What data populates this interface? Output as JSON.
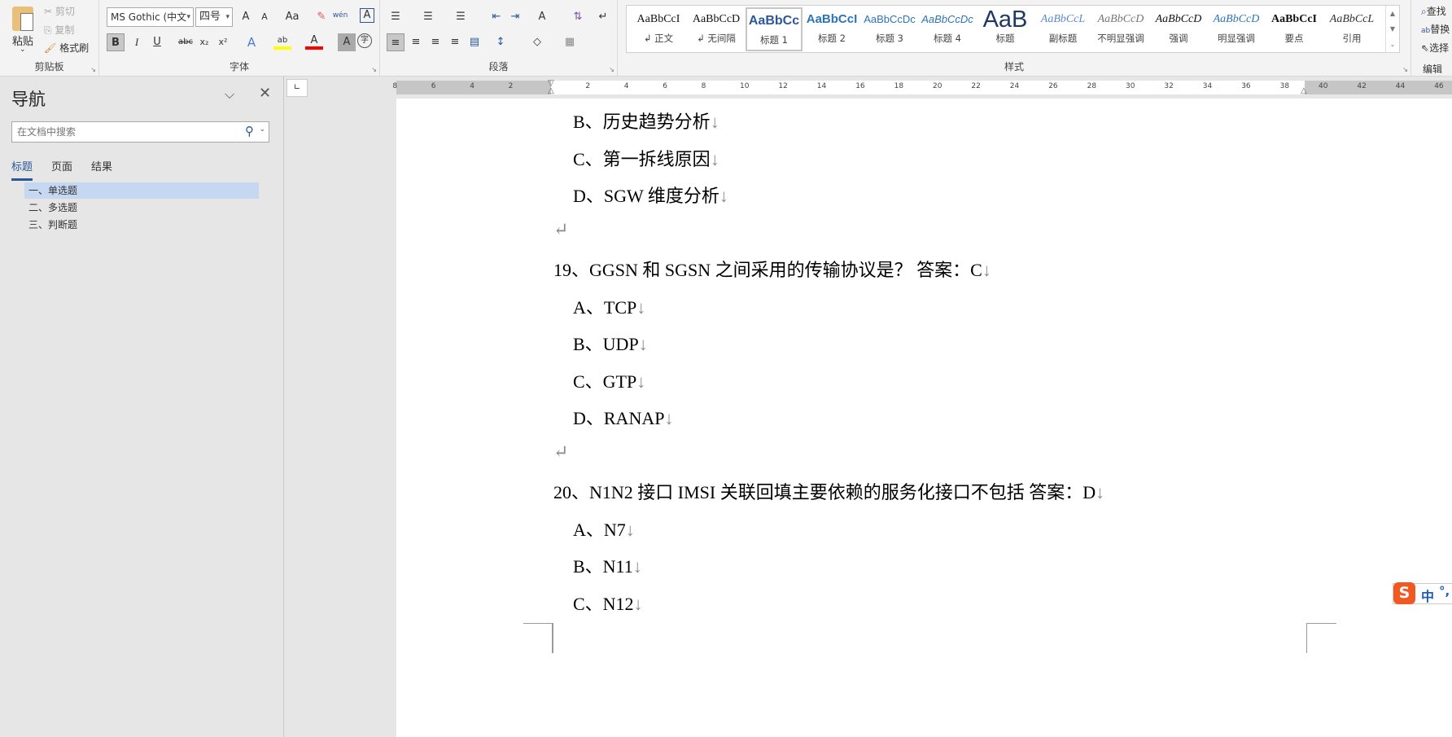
{
  "ribbon": {
    "clipboard": {
      "paste": "粘贴",
      "cut": "剪切",
      "copy": "复制",
      "format_painter": "格式刷",
      "label": "剪贴板"
    },
    "font": {
      "font_name": "MS Gothic (中文",
      "font_size": "四号",
      "label": "字体",
      "bold": "B",
      "italic": "I",
      "underline": "U",
      "strike": "abc",
      "sub": "x₂",
      "sup": "x²",
      "change_case": "Aa",
      "grow": "A",
      "shrink": "A",
      "phonetic": "wén",
      "border": "A",
      "effects": "A",
      "highlight": "ab",
      "color": "A",
      "shading": "A",
      "enclose": "字"
    },
    "paragraph": {
      "label": "段落"
    },
    "styles": {
      "label": "样式",
      "items": [
        {
          "preview": "AaBbCcI",
          "name": "↲ 正文"
        },
        {
          "preview": "AaBbCcD",
          "name": "↲ 无间隔"
        },
        {
          "preview": "AaBbCc",
          "name": "标题 1"
        },
        {
          "preview": "AaBbCcI",
          "name": "标题 2"
        },
        {
          "preview": "AaBbCcDc",
          "name": "标题 3"
        },
        {
          "preview": "AaBbCcDc",
          "name": "标题 4"
        },
        {
          "preview": "AaB",
          "name": "标题"
        },
        {
          "preview": "AaBbCcL",
          "name": "副标题"
        },
        {
          "preview": "AaBbCcD",
          "name": "不明显强调"
        },
        {
          "preview": "AaBbCcD",
          "name": "强调"
        },
        {
          "preview": "AaBbCcD",
          "name": "明显强调"
        },
        {
          "preview": "AaBbCcI",
          "name": "要点"
        },
        {
          "preview": "AaBbCcL",
          "name": "引用"
        }
      ]
    },
    "editing": {
      "find": "查找",
      "replace": "替换",
      "select": "选择",
      "label": "编辑"
    }
  },
  "nav": {
    "title": "导航",
    "search_placeholder": "在文档中搜索",
    "tabs": [
      "标题",
      "页面",
      "结果"
    ],
    "active_tab": "标题",
    "headings": [
      "一、单选题",
      "二、多选题",
      "三、判断题"
    ],
    "selected": "一、单选题"
  },
  "ruler": {
    "left": [
      "8",
      "6",
      "4",
      "2"
    ],
    "right": [
      "2",
      "4",
      "6",
      "8",
      "10",
      "12",
      "14",
      "16",
      "18",
      "20",
      "22",
      "24",
      "26",
      "28",
      "30",
      "32",
      "34",
      "36",
      "38",
      "40",
      "42",
      "44",
      "46"
    ]
  },
  "doc": {
    "lines": [
      {
        "text": "B、历史趋势分析",
        "indent": true,
        "mark": "↓"
      },
      {
        "text": "C、第一拆线原因",
        "indent": true,
        "mark": "↓"
      },
      {
        "text": "D、SGW 维度分析",
        "indent": true,
        "mark": "↓"
      },
      {
        "text": "",
        "indent": false,
        "mark": "↵"
      },
      {
        "text": "19、GGSN 和 SGSN 之间采用的传输协议是？  答案：C",
        "indent": false,
        "mark": "↓"
      },
      {
        "text": "A、TCP",
        "indent": true,
        "mark": "↓"
      },
      {
        "text": "B、UDP",
        "indent": true,
        "mark": "↓"
      },
      {
        "text": "C、GTP",
        "indent": true,
        "mark": "↓"
      },
      {
        "text": "D、RANAP",
        "indent": true,
        "mark": "↓"
      },
      {
        "text": "",
        "indent": false,
        "mark": "↵"
      },
      {
        "text": "20、N1N2 接口 IMSI 关联回填主要依赖的服务化接口不包括  答案：D",
        "indent": false,
        "mark": "↓"
      },
      {
        "text": "A、N7",
        "indent": true,
        "mark": "↓"
      },
      {
        "text": "B、N11",
        "indent": true,
        "mark": "↓"
      },
      {
        "text": "C、N12",
        "indent": true,
        "mark": "↓"
      }
    ]
  },
  "ime": {
    "mode": "中",
    "punct": "°,"
  },
  "colors": {
    "accent": "#2b579a",
    "highlight": "#ffff00",
    "font_color": "#ff0000",
    "nav_selected": "#c5d7f1",
    "ime": "#f05a22"
  }
}
